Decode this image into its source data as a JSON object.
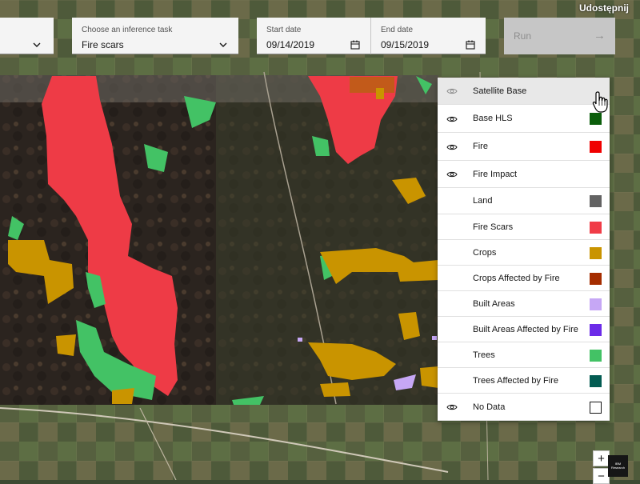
{
  "toolbar": {
    "task_field": {
      "label": "Choose an inference task",
      "value": "Fire scars",
      "icon": "chevron-down-icon"
    },
    "start_date": {
      "label": "Start date",
      "value": "09/14/2019",
      "icon": "calendar-icon"
    },
    "end_date": {
      "label": "End date",
      "value": "09/15/2019",
      "icon": "calendar-icon"
    },
    "run_label": "Run",
    "run_icon": "arrow-right-icon",
    "share_label": "Udostępnij"
  },
  "legend": {
    "items": [
      {
        "label": "Satellite Base",
        "eye": true,
        "highlighted": true
      },
      {
        "label": "Base HLS",
        "eye": true,
        "color": "#0b5e0b"
      },
      {
        "label": "Fire",
        "eye": true,
        "color": "#f00000"
      },
      {
        "label": "Fire Impact",
        "eye": true
      },
      {
        "label": "Land",
        "eye": false,
        "color": "#636363"
      },
      {
        "label": "Fire Scars",
        "eye": false,
        "color": "#f03c47"
      },
      {
        "label": "Crops",
        "eye": false,
        "color": "#c99400"
      },
      {
        "label": "Crops Affected by Fire",
        "eye": false,
        "color": "#a52d00"
      },
      {
        "label": "Built Areas",
        "eye": false,
        "color": "#c6a7f5"
      },
      {
        "label": "Built Areas Affected by Fire",
        "eye": false,
        "color": "#6c2be8"
      },
      {
        "label": "Trees",
        "eye": false,
        "color": "#43c265"
      },
      {
        "label": "Trees Affected by Fire",
        "eye": false,
        "color": "#035c52"
      },
      {
        "label": "No Data",
        "eye": true,
        "color": "#ffffff"
      }
    ]
  },
  "map_controls": {
    "zoom_in": "+",
    "zoom_out": "−"
  },
  "badge": {
    "text": "IBM Research"
  }
}
